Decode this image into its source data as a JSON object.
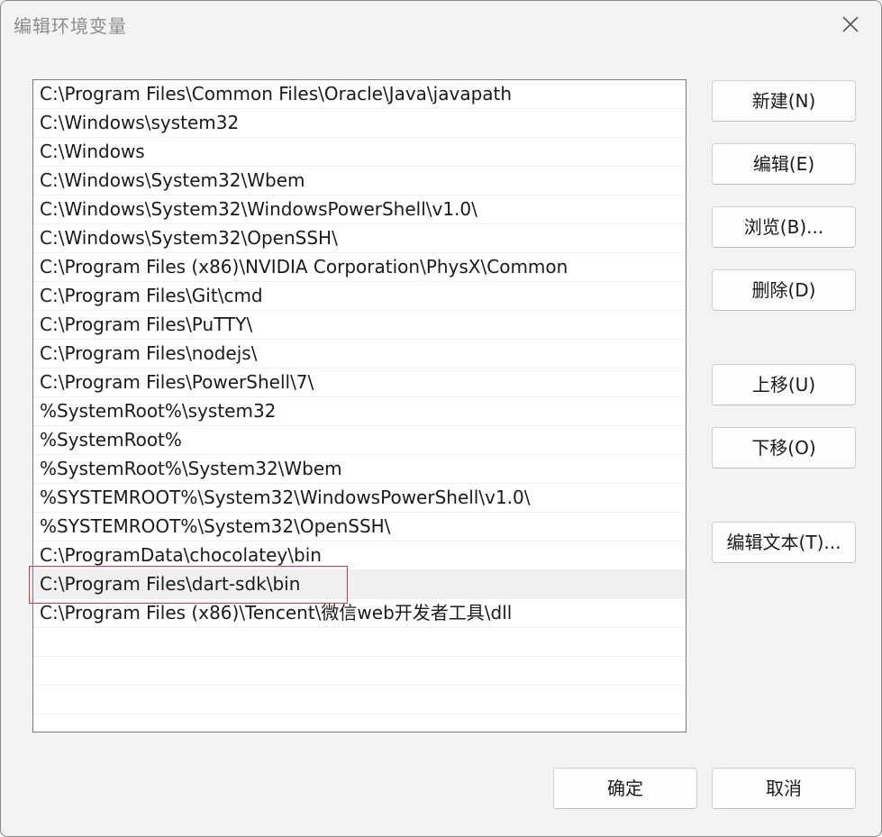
{
  "window": {
    "title": "编辑环境变量",
    "close_icon": "close-icon"
  },
  "paths": [
    "C:\\Program Files\\Common Files\\Oracle\\Java\\javapath",
    "C:\\Windows\\system32",
    "C:\\Windows",
    "C:\\Windows\\System32\\Wbem",
    "C:\\Windows\\System32\\WindowsPowerShell\\v1.0\\",
    "C:\\Windows\\System32\\OpenSSH\\",
    "C:\\Program Files (x86)\\NVIDIA Corporation\\PhysX\\Common",
    "C:\\Program Files\\Git\\cmd",
    "C:\\Program Files\\PuTTY\\",
    "C:\\Program Files\\nodejs\\",
    "C:\\Program Files\\PowerShell\\7\\",
    "%SystemRoot%\\system32",
    "%SystemRoot%",
    "%SystemRoot%\\System32\\Wbem",
    "%SYSTEMROOT%\\System32\\WindowsPowerShell\\v1.0\\",
    "%SYSTEMROOT%\\System32\\OpenSSH\\",
    "C:\\ProgramData\\chocolatey\\bin",
    "C:\\Program Files\\dart-sdk\\bin",
    "C:\\Program Files (x86)\\Tencent\\微信web开发者工具\\dll",
    "",
    "",
    ""
  ],
  "selected_index": 17,
  "buttons": {
    "new": "新建(N)",
    "edit": "编辑(E)",
    "browse": "浏览(B)...",
    "delete": "删除(D)",
    "move_up": "上移(U)",
    "move_down": "下移(O)",
    "edit_text": "编辑文本(T)...",
    "ok": "确定",
    "cancel": "取消"
  },
  "colors": {
    "highlight_border": "#d9363e",
    "selected_row": "#f0f0f0"
  }
}
